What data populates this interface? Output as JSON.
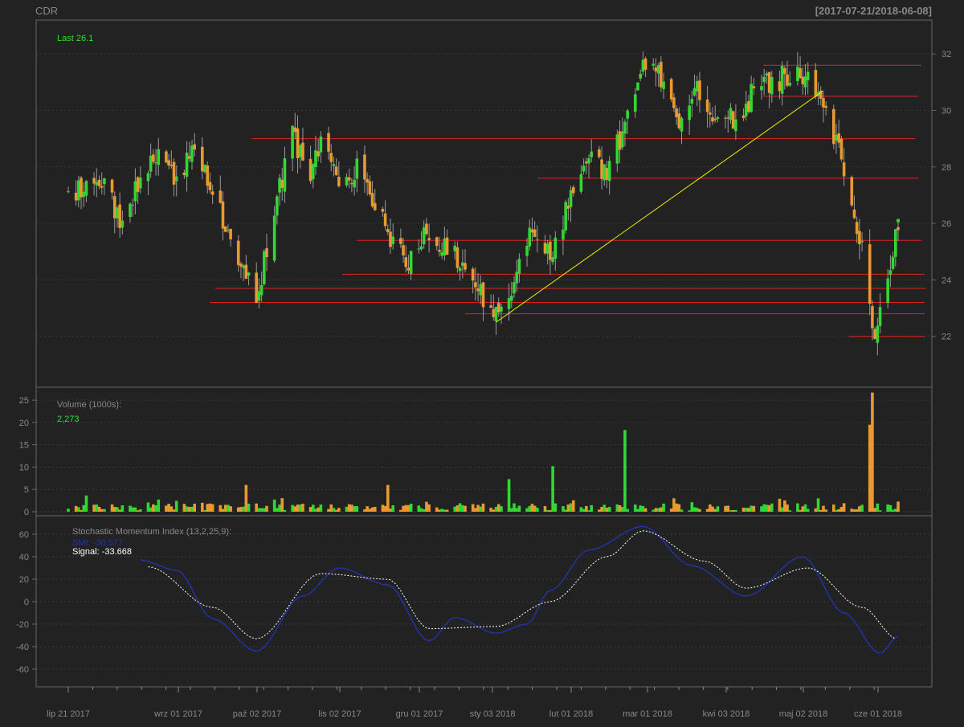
{
  "header": {
    "symbol": "CDR",
    "date_range": "[2017-07-21/2018-06-08]"
  },
  "colors": {
    "background": "#222222",
    "panel_border": "#666666",
    "grid": "#3a3a3a",
    "label": "#888888",
    "up": "#33d633",
    "down": "#e89a2e",
    "wick": "#999999",
    "last_text": "#33dd33",
    "resistance_lines": "#dd2222",
    "trendline": "#eeee00",
    "smi_line": "#2233aa",
    "signal_line": "#ffffff"
  },
  "price_panel": {
    "last_label": "Last 26.1",
    "y_ticks": [
      "32",
      "30",
      "28",
      "26",
      "24",
      "22"
    ]
  },
  "volume_panel": {
    "title": "Volume (1000s):",
    "last_value": "2,273",
    "y_ticks": [
      "25",
      "20",
      "15",
      "10",
      "5",
      "0"
    ]
  },
  "smi_panel": {
    "title": "Stochastic Momentum Index (13,2,25,9):",
    "smi_label": "SMI: -30.577",
    "signal_label": "Signal: -33.668",
    "y_ticks": [
      "60",
      "40",
      "20",
      "0",
      "-20",
      "-40",
      "-60"
    ]
  },
  "x_axis": {
    "labels": [
      "lip 21 2017",
      "wrz 01 2017",
      "paź 02 2017",
      "lis 02 2017",
      "gru 01 2017",
      "sty 03 2018",
      "lut 01 2018",
      "mar 01 2018",
      "kwi 03 2018",
      "maj 02 2018",
      "cze 01 2018"
    ]
  },
  "chart_data": [
    {
      "type": "candlestick",
      "title": "CDR",
      "ylim": [
        20.2,
        33.2
      ],
      "x_range": [
        "2017-07-21",
        "2018-06-08"
      ],
      "last": 26.1,
      "close_trajectory": [
        {
          "x": "2017-07-21",
          "y": 27.0
        },
        {
          "x": "2017-08-04",
          "y": 27.4
        },
        {
          "x": "2017-08-11",
          "y": 26.0
        },
        {
          "x": "2017-08-18",
          "y": 27.5
        },
        {
          "x": "2017-08-25",
          "y": 28.6
        },
        {
          "x": "2017-09-01",
          "y": 27.6
        },
        {
          "x": "2017-09-08",
          "y": 28.8
        },
        {
          "x": "2017-09-15",
          "y": 26.8
        },
        {
          "x": "2017-09-22",
          "y": 25.6
        },
        {
          "x": "2017-09-29",
          "y": 24.1
        },
        {
          "x": "2017-10-02",
          "y": 23.4
        },
        {
          "x": "2017-10-06",
          "y": 25.0
        },
        {
          "x": "2017-10-11",
          "y": 27.3
        },
        {
          "x": "2017-10-16",
          "y": 29.1
        },
        {
          "x": "2017-10-23",
          "y": 27.8
        },
        {
          "x": "2017-10-27",
          "y": 28.9
        },
        {
          "x": "2017-11-03",
          "y": 27.4
        },
        {
          "x": "2017-11-10",
          "y": 27.9
        },
        {
          "x": "2017-11-17",
          "y": 26.7
        },
        {
          "x": "2017-11-24",
          "y": 25.1
        },
        {
          "x": "2017-11-30",
          "y": 24.6
        },
        {
          "x": "2017-12-07",
          "y": 25.6
        },
        {
          "x": "2017-12-14",
          "y": 25.2
        },
        {
          "x": "2017-12-21",
          "y": 24.5
        },
        {
          "x": "2017-12-28",
          "y": 23.5
        },
        {
          "x": "2018-01-03",
          "y": 22.9
        },
        {
          "x": "2018-01-10",
          "y": 24.0
        },
        {
          "x": "2018-01-17",
          "y": 25.8
        },
        {
          "x": "2018-01-24",
          "y": 24.9
        },
        {
          "x": "2018-02-01",
          "y": 26.9
        },
        {
          "x": "2018-02-08",
          "y": 28.4
        },
        {
          "x": "2018-02-15",
          "y": 27.6
        },
        {
          "x": "2018-02-22",
          "y": 29.6
        },
        {
          "x": "2018-03-01",
          "y": 31.9
        },
        {
          "x": "2018-03-08",
          "y": 31.1
        },
        {
          "x": "2018-03-15",
          "y": 29.6
        },
        {
          "x": "2018-03-22",
          "y": 30.6
        },
        {
          "x": "2018-03-29",
          "y": 29.4
        },
        {
          "x": "2018-04-05",
          "y": 29.7
        },
        {
          "x": "2018-04-12",
          "y": 30.5
        },
        {
          "x": "2018-04-19",
          "y": 31.0
        },
        {
          "x": "2018-04-26",
          "y": 31.2
        },
        {
          "x": "2018-05-04",
          "y": 31.1
        },
        {
          "x": "2018-05-11",
          "y": 30.3
        },
        {
          "x": "2018-05-18",
          "y": 27.8
        },
        {
          "x": "2018-05-25",
          "y": 25.0
        },
        {
          "x": "2018-05-30",
          "y": 22.1
        },
        {
          "x": "2018-06-04",
          "y": 24.0
        },
        {
          "x": "2018-06-08",
          "y": 26.1
        }
      ],
      "horizontal_lines": [
        31.6,
        30.5,
        29.0,
        27.6,
        25.4,
        24.2,
        23.7,
        23.2,
        22.8,
        22.0
      ],
      "trendline": [
        {
          "x": "2018-01-03",
          "y": 22.5
        },
        {
          "x": "2018-05-10",
          "y": 30.7
        }
      ]
    },
    {
      "type": "bar",
      "title": "Volume (1000s):",
      "ylim": [
        0,
        27
      ],
      "last": 2.273,
      "peaks": [
        {
          "x": "2017-09-28",
          "y": 6.0
        },
        {
          "x": "2017-11-22",
          "y": 6.0
        },
        {
          "x": "2018-01-08",
          "y": 7.3
        },
        {
          "x": "2018-01-25",
          "y": 10.2
        },
        {
          "x": "2018-02-22",
          "y": 18.3
        },
        {
          "x": "2018-05-28",
          "y": 19.5
        },
        {
          "x": "2018-05-29",
          "y": 26.7
        }
      ]
    },
    {
      "type": "line",
      "title": "Stochastic Momentum Index (13,2,25,9):",
      "ylim": [
        -75,
        75
      ],
      "series": [
        {
          "name": "SMI",
          "last": -30.577,
          "values": [
            {
              "x": "2017-08-18",
              "y": 37
            },
            {
              "x": "2017-09-01",
              "y": 28
            },
            {
              "x": "2017-09-15",
              "y": -15
            },
            {
              "x": "2017-10-02",
              "y": -44
            },
            {
              "x": "2017-10-20",
              "y": 5
            },
            {
              "x": "2017-11-03",
              "y": 30
            },
            {
              "x": "2017-11-22",
              "y": 15
            },
            {
              "x": "2017-12-08",
              "y": -35
            },
            {
              "x": "2017-12-18",
              "y": -14
            },
            {
              "x": "2018-01-03",
              "y": -28
            },
            {
              "x": "2018-01-15",
              "y": -20
            },
            {
              "x": "2018-01-24",
              "y": 10
            },
            {
              "x": "2018-02-08",
              "y": 46
            },
            {
              "x": "2018-03-01",
              "y": 67
            },
            {
              "x": "2018-03-20",
              "y": 32
            },
            {
              "x": "2018-04-10",
              "y": 5
            },
            {
              "x": "2018-05-02",
              "y": 40
            },
            {
              "x": "2018-05-18",
              "y": -10
            },
            {
              "x": "2018-06-01",
              "y": -46
            },
            {
              "x": "2018-06-08",
              "y": -30.577
            }
          ]
        },
        {
          "name": "Signal",
          "last": -33.668,
          "values": [
            {
              "x": "2017-08-21",
              "y": 31
            },
            {
              "x": "2017-09-15",
              "y": -5
            },
            {
              "x": "2017-10-02",
              "y": -33
            },
            {
              "x": "2017-10-27",
              "y": 25
            },
            {
              "x": "2017-11-22",
              "y": 20
            },
            {
              "x": "2017-12-08",
              "y": -24
            },
            {
              "x": "2018-01-03",
              "y": -22
            },
            {
              "x": "2018-01-24",
              "y": 0
            },
            {
              "x": "2018-02-15",
              "y": 40
            },
            {
              "x": "2018-03-01",
              "y": 63
            },
            {
              "x": "2018-03-25",
              "y": 36
            },
            {
              "x": "2018-04-10",
              "y": 12
            },
            {
              "x": "2018-05-04",
              "y": 30
            },
            {
              "x": "2018-05-25",
              "y": -5
            },
            {
              "x": "2018-06-08",
              "y": -33.668
            }
          ]
        }
      ]
    }
  ]
}
